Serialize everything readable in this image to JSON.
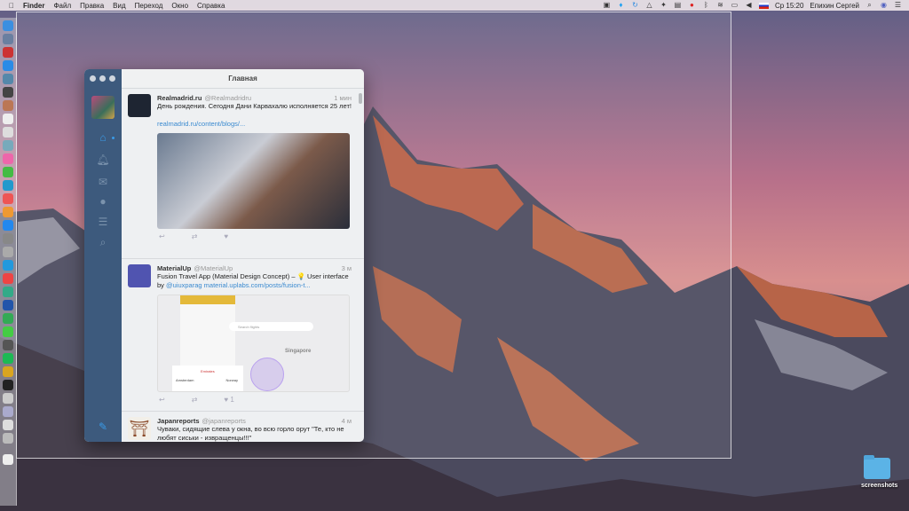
{
  "menubar": {
    "app": "Finder",
    "items": [
      "Файл",
      "Правка",
      "Вид",
      "Переход",
      "Окно",
      "Справка"
    ],
    "clock": "Ср 15:20",
    "user": "Епихин Сергей"
  },
  "desktop": {
    "folder": "screenshots"
  },
  "window": {
    "title": "Главная",
    "tweets": [
      {
        "name": "Realmadrid.ru",
        "handle": "@Realmadridru",
        "time": "1 мин",
        "text": "День рождения. Сегодня Дани Карвахалю исполняется 25 лет!",
        "link": "realmadrid.ru/content/blogs/..."
      },
      {
        "name": "MaterialUp",
        "handle": "@MaterialUp",
        "time": "3 м",
        "text": "Fusion Travel App (Material Design Concept) – 💡 User interface by ",
        "mention": "@uiuxparag",
        "link": "material.uplabs.com/posts/fusion-t...",
        "likes": "1",
        "image_labels": {
          "search": "Search flights",
          "city": "Singapore",
          "from": "Amsterdam",
          "to": "Norway",
          "brand": "Emirates"
        }
      },
      {
        "name": "Japanreports",
        "handle": "@japanreports",
        "time": "4 м",
        "text": "Чуваки, сидящие слева у окна, во всю горло орут \"Те, кто не любят сиськи - извращенцы!!!\""
      }
    ]
  }
}
